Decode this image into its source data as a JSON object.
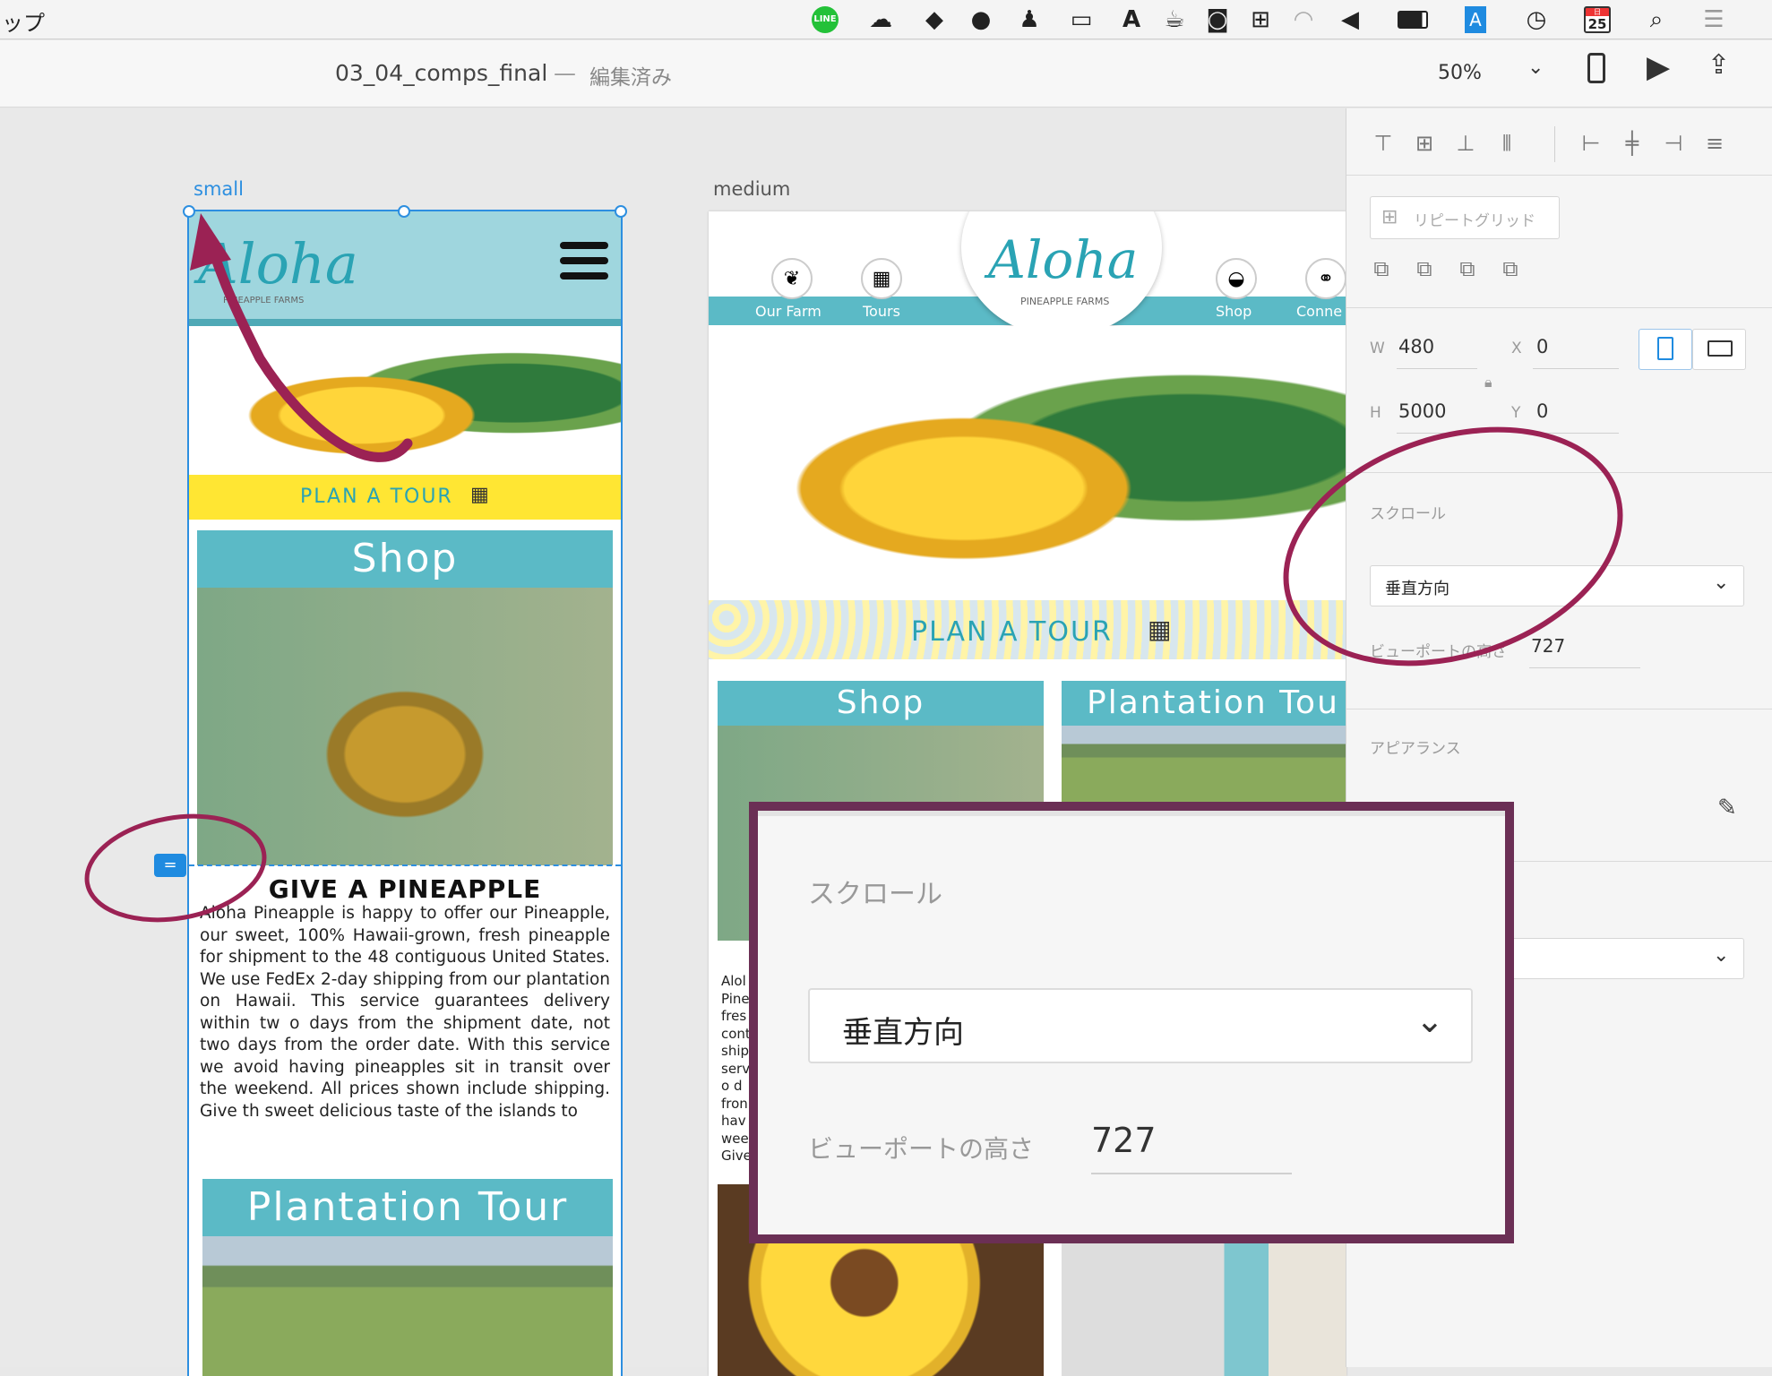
{
  "menubar": {
    "app_fragment": "ップ",
    "icons": [
      "line-icon",
      "creative-cloud-icon",
      "dropbox-icon",
      "circle-icon",
      "person-icon",
      "camera-video-icon",
      "font-a-icon",
      "coffee-icon",
      "screenshot-icon",
      "train-icon",
      "wifi-icon",
      "volume-icon",
      "battery-icon",
      "text-a-icon",
      "clock-icon",
      "calendar-icon",
      "search-icon",
      "list-icon"
    ],
    "calendar": {
      "month": "日",
      "day": "25"
    }
  },
  "appbar": {
    "doc_title": "03_04_comps_final",
    "separator": "—",
    "status": "編集済み",
    "zoom": "50%"
  },
  "artboards": {
    "small": {
      "label": "small",
      "logo": "Aloha",
      "logo_sub": "PINEAPPLE FARMS",
      "plan_tour": "PLAN A TOUR",
      "shop_title": "Shop",
      "give_title": "GIVE A PINEAPPLE",
      "body": "Aloha Pineapple is happy to offer our Pineapple, our sweet, 100% Hawaii-grown, fresh pineapple for shipment to the 48 contiguous United States. We use FedEx 2-day shipping from our plantation on Hawaii. This service guarantees delivery within tw o days from the shipment date, not two days from the order date. With this service we avoid having pineapples sit in transit over the weekend. All prices shown include shipping. Give th sweet delicious taste of the islands to",
      "plantation_title": "Plantation Tour"
    },
    "medium": {
      "label": "medium",
      "logo": "Aloha",
      "logo_sub": "PINEAPPLE FARMS",
      "nav": [
        "Our Farm",
        "Tours",
        "Shop",
        "Conne"
      ],
      "plan_tour": "PLAN A TOUR",
      "shop_title": "Shop",
      "plantation_title": "Plantation Tou",
      "text_fragments": [
        "Alol",
        "Pine",
        "fres",
        "cont",
        "ship",
        "serv",
        "o d",
        "fron",
        "hav",
        "wee",
        "Give"
      ]
    }
  },
  "panel": {
    "repeat_grid": "リピートグリッド",
    "w_label": "W",
    "w_value": "480",
    "h_label": "H",
    "h_value": "5000",
    "x_label": "X",
    "x_value": "0",
    "y_label": "Y",
    "y_value": "0",
    "scroll_label": "スクロール",
    "scroll_value": "垂直方向",
    "viewport_label": "ビューポートの高さ",
    "viewport_value": "727",
    "appearance_label": "アピアランス"
  },
  "callout": {
    "scroll_label": "スクロール",
    "scroll_value": "垂直方向",
    "viewport_label": "ビューポートの高さ",
    "viewport_value": "727"
  },
  "colors": {
    "selection": "#2d8fe0",
    "annotation": "#9b2254",
    "callout_border": "#6b2f55",
    "teal": "#5bbac6",
    "yellow": "#ffe633"
  }
}
